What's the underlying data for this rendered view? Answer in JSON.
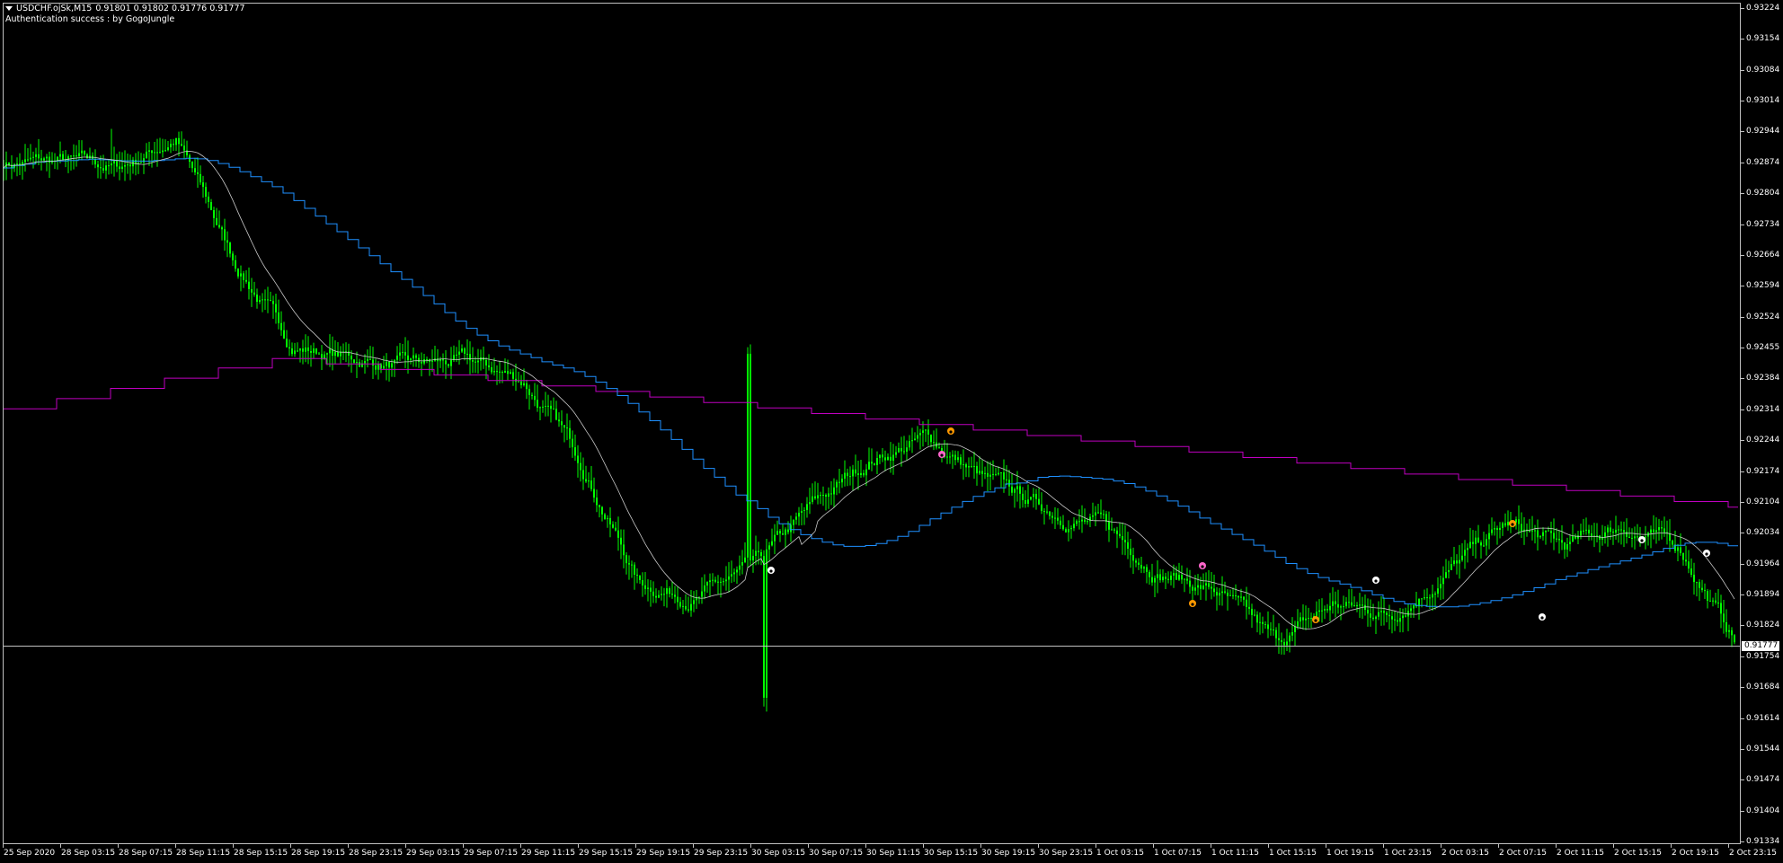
{
  "header": {
    "symbol": "USDCHF.ojSk,M15",
    "ohlc": "0.91801 0.91802 0.91776 0.91777",
    "auth_text": "Authentication success : by GogoJungle"
  },
  "price_axis": {
    "labels": [
      "0.93224",
      "0.93154",
      "0.93084",
      "0.93014",
      "0.92944",
      "0.92874",
      "0.92804",
      "0.92734",
      "0.92664",
      "0.92594",
      "0.92524",
      "0.92455",
      "0.92384",
      "0.92314",
      "0.92244",
      "0.92174",
      "0.92104",
      "0.92034",
      "0.91964",
      "0.91894",
      "0.91824",
      "0.91754",
      "0.91684",
      "0.91614",
      "0.91544",
      "0.91474",
      "0.91404",
      "0.91334"
    ],
    "current_bid": "0.91777"
  },
  "time_axis": {
    "labels": [
      "25 Sep 2020",
      "28 Sep 03:15",
      "28 Sep 07:15",
      "28 Sep 11:15",
      "28 Sep 15:15",
      "28 Sep 19:15",
      "28 Sep 23:15",
      "29 Sep 03:15",
      "29 Sep 07:15",
      "29 Sep 11:15",
      "29 Sep 15:15",
      "29 Sep 19:15",
      "29 Sep 23:15",
      "30 Sep 03:15",
      "30 Sep 07:15",
      "30 Sep 11:15",
      "30 Sep 15:15",
      "30 Sep 19:15",
      "30 Sep 23:15",
      "1 Oct 03:15",
      "1 Oct 07:15",
      "1 Oct 11:15",
      "1 Oct 15:15",
      "1 Oct 19:15",
      "1 Oct 23:15",
      "2 Oct 03:15",
      "2 Oct 07:15",
      "2 Oct 11:15",
      "2 Oct 15:15",
      "2 Oct 19:15",
      "2 Oct 23:15"
    ]
  },
  "colors": {
    "background": "#000000",
    "candles": "#00ff00",
    "ma_fast": "#c8c8c8",
    "ma_blue": "#1e90ff",
    "ma_magenta": "#c000c0",
    "bid_line": "#c0c0c0",
    "signal_orange": "#ff9900",
    "signal_pink": "#ff66cc",
    "signal_white": "#ffffff"
  },
  "chart_data": {
    "type": "candlestick",
    "timeframe": "M15",
    "ylim": [
      0.91334,
      0.93224
    ],
    "approx_close_path": [
      [
        "25 Sep 2020",
        0.92874
      ],
      [
        "28 Sep 03:15",
        0.92874
      ],
      [
        "28 Sep 07:15",
        0.9286
      ],
      [
        "28 Sep 11:15",
        0.9293
      ],
      [
        "28 Sep 15:15",
        0.9265
      ],
      [
        "28 Sep 19:15",
        0.9246
      ],
      [
        "28 Sep 23:15",
        0.9243
      ],
      [
        "29 Sep 03:15",
        0.9241
      ],
      [
        "29 Sep 07:15",
        0.9242
      ],
      [
        "29 Sep 11:15",
        0.9238
      ],
      [
        "29 Sep 15:15",
        0.922
      ],
      [
        "29 Sep 19:15",
        0.9192
      ],
      [
        "29 Sep 23:15",
        0.9189
      ],
      [
        "30 Sep 03:15",
        0.9195
      ],
      [
        "30 Sep 07:15",
        0.9209
      ],
      [
        "30 Sep 11:15",
        0.922
      ],
      [
        "30 Sep 15:15",
        0.9225
      ],
      [
        "30 Sep 19:15",
        0.9215
      ],
      [
        "30 Sep 23:15",
        0.9209
      ],
      [
        "1 Oct 03:15",
        0.9205
      ],
      [
        "1 Oct 07:15",
        0.9195
      ],
      [
        "1 Oct 11:15",
        0.919
      ],
      [
        "1 Oct 15:15",
        0.9178
      ],
      [
        "1 Oct 19:15",
        0.9187
      ],
      [
        "1 Oct 23:15",
        0.9185
      ],
      [
        "2 Oct 03:15",
        0.9195
      ],
      [
        "2 Oct 07:15",
        0.9205
      ],
      [
        "2 Oct 11:15",
        0.92
      ],
      [
        "2 Oct 15:15",
        0.9205
      ],
      [
        "2 Oct 19:15",
        0.92
      ],
      [
        "2 Oct 23:15",
        0.91777
      ]
    ],
    "extremes": {
      "high": 0.9295,
      "low": 0.9164
    }
  }
}
